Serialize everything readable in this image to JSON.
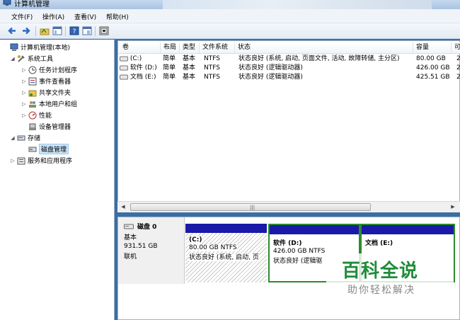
{
  "window": {
    "title": "计算机管理"
  },
  "menu": [
    {
      "label": "文件(F)"
    },
    {
      "label": "操作(A)"
    },
    {
      "label": "查看(V)"
    },
    {
      "label": "帮助(H)"
    }
  ],
  "toolbar": {
    "icons": [
      "back-arrow-icon",
      "forward-arrow-icon",
      "folder-up-icon",
      "show-tree-icon",
      "help-icon",
      "properties-icon",
      "refresh-icon"
    ]
  },
  "tree": [
    {
      "label": "计算机管理(本地)",
      "icon": "computer-icon",
      "level": 0,
      "arrow": ""
    },
    {
      "label": "系统工具",
      "icon": "tools-icon",
      "level": 1,
      "arrow": "◢"
    },
    {
      "label": "任务计划程序",
      "icon": "clock-icon",
      "level": 2,
      "arrow": "▷"
    },
    {
      "label": "事件查看器",
      "icon": "event-viewer-icon",
      "level": 2,
      "arrow": "▷"
    },
    {
      "label": "共享文件夹",
      "icon": "shared-folder-icon",
      "level": 2,
      "arrow": "▷"
    },
    {
      "label": "本地用户和组",
      "icon": "users-icon",
      "level": 2,
      "arrow": "▷"
    },
    {
      "label": "性能",
      "icon": "performance-icon",
      "level": 2,
      "arrow": "▷"
    },
    {
      "label": "设备管理器",
      "icon": "device-manager-icon",
      "level": 2,
      "arrow": ""
    },
    {
      "label": "存储",
      "icon": "storage-icon",
      "level": 1,
      "arrow": "◢"
    },
    {
      "label": "磁盘管理",
      "icon": "disk-management-icon",
      "level": 2,
      "arrow": "",
      "selected": true
    },
    {
      "label": "服务和应用程序",
      "icon": "services-icon",
      "level": 1,
      "arrow": "▷"
    }
  ],
  "volumes": {
    "columns": [
      "卷",
      "布局",
      "类型",
      "文件系统",
      "状态",
      "容量",
      "可"
    ],
    "rows": [
      {
        "volume": "(C:)",
        "layout": "简单",
        "type": "基本",
        "fs": "NTFS",
        "status": "状态良好 (系统, 启动, 页面文件, 活动, 故障转储, 主分区)",
        "capacity": "80.00 GB",
        "free": "2"
      },
      {
        "volume": "软件 (D:)",
        "layout": "简单",
        "type": "基本",
        "fs": "NTFS",
        "status": "状态良好 (逻辑驱动器)",
        "capacity": "426.00 GB",
        "free": "2"
      },
      {
        "volume": "文档 (E:)",
        "layout": "简单",
        "type": "基本",
        "fs": "NTFS",
        "status": "状态良好 (逻辑驱动器)",
        "capacity": "425.51 GB",
        "free": "2"
      }
    ]
  },
  "scrollbar": {
    "grip": "|||"
  },
  "disk": {
    "name": "磁盘 0",
    "type": "基本",
    "size": "931.51 GB",
    "state": "联机",
    "partitions": [
      {
        "name": "(C:)",
        "size": "80.00 GB NTFS",
        "status": "状态良好 (系统, 启动, 页"
      },
      {
        "name": "软件  (D:)",
        "size": "426.00 GB NTFS",
        "status": "状态良好 (逻辑驱"
      },
      {
        "name": "文档  (E:)",
        "size": "",
        "status": ""
      }
    ]
  },
  "watermark": {
    "title": "百科全说",
    "subtitle": "助你轻松解决"
  }
}
